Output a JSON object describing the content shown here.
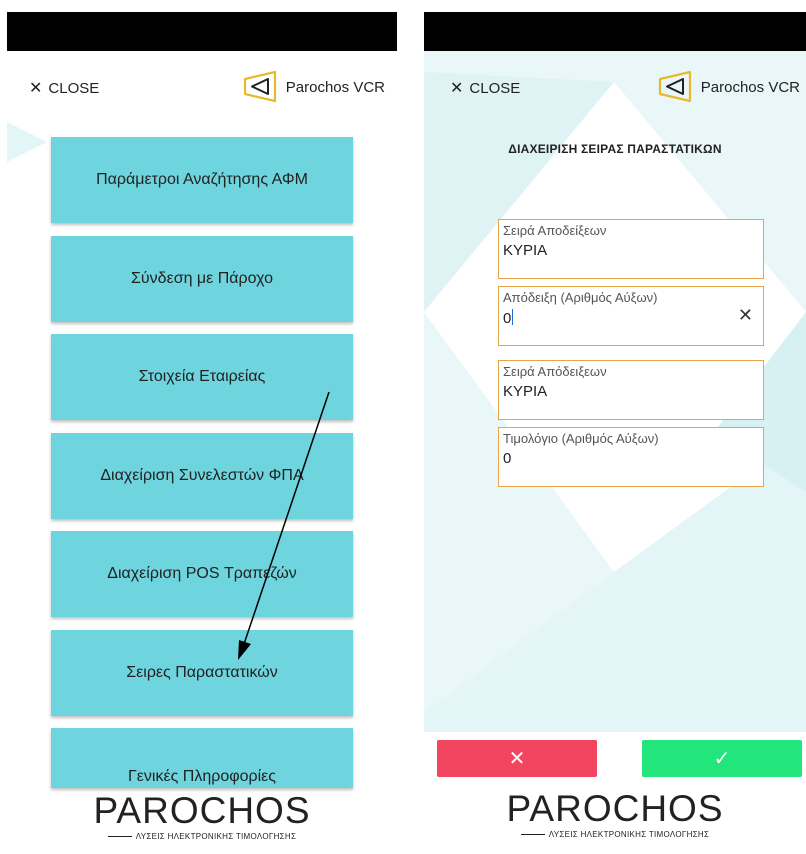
{
  "left_screen": {
    "close_label": "CLOSE",
    "brand_name": "Parochos VCR",
    "menu_items": [
      {
        "label": "Παράμετροι Αναζήτησης ΑΦΜ"
      },
      {
        "label": "Σύνδεση με Πάροχο"
      },
      {
        "label": "Στοιχεία Εταιρείας"
      },
      {
        "label": "Διαχείριση Συνελεστών ΦΠΑ"
      },
      {
        "label": "Διαχείριση POS Τραπεζών"
      },
      {
        "label": "Σειρες Παραστατικών"
      },
      {
        "label": "Γενικές Πληροφορίες"
      }
    ],
    "logo": "PAROCHOS",
    "logo_tagline": "ΛΥΣΕΙΣ ΗΛΕΚΤΡΟΝΙΚΗΣ ΤΙΜΟΛΟΓΗΣΗΣ"
  },
  "right_screen": {
    "close_label": "CLOSE",
    "brand_name": "Parochos VCR",
    "title": "ΔΙΑΧΕΙΡΙΣΗ ΣΕΙΡΑΣ ΠΑΡΑΣΤΑΤΙΚΩΝ",
    "fields": [
      {
        "label": "Σειρά Αποδείξεων",
        "value": "ΚΥΡΙΑ"
      },
      {
        "label": "Απόδειξη (Αριθμός Αύξων)",
        "value": "0"
      },
      {
        "label": "Σειρά Απόδειξεων",
        "value": "ΚΥΡΙΑ"
      },
      {
        "label": "Τιμολόγιο (Αριθμός Αύξων)",
        "value": "0"
      }
    ],
    "cancel_symbol": "✕",
    "confirm_symbol": "✓",
    "logo": "PAROCHOS",
    "logo_tagline": "ΛΥΣΕΙΣ ΗΛΕΚΤΡΟΝΙΚΗΣ ΤΙΜΟΛΟΓΗΣΗΣ"
  },
  "colors": {
    "menu_button": "#6ed4de",
    "field_border": "#e8a548",
    "cancel_button": "#f2455f",
    "confirm_button": "#22e57c",
    "brand_logo": "#e8b92a"
  },
  "icons": {
    "close": "close-icon",
    "brand": "parochos-logo-icon",
    "field_clear": "clear-icon",
    "cancel": "x-icon",
    "confirm": "check-icon"
  }
}
